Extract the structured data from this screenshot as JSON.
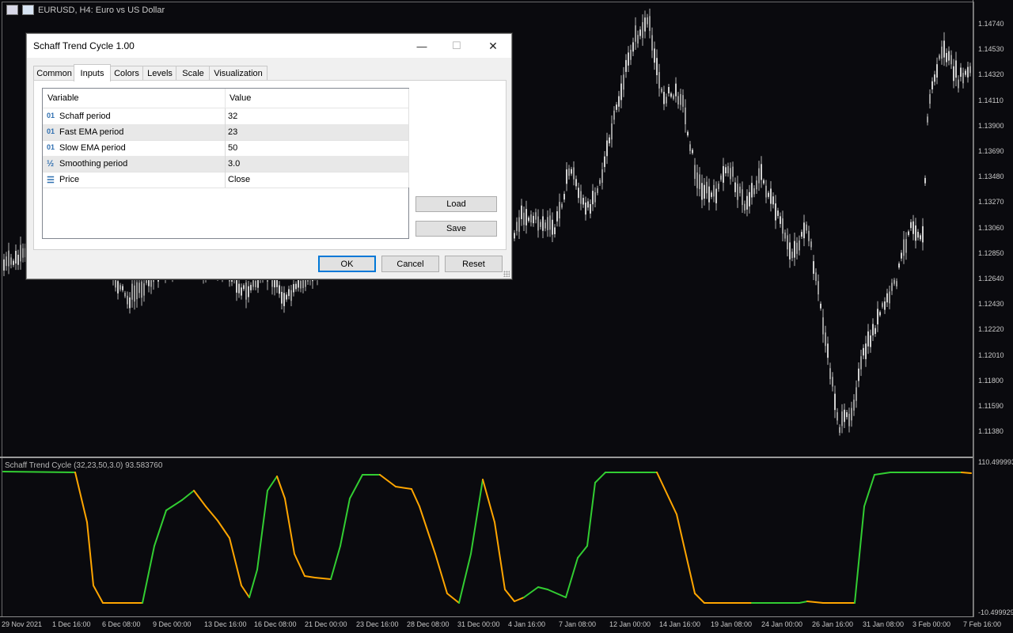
{
  "chart": {
    "title": "EURUSD, H4:  Euro vs US Dollar",
    "indicator_label": "Schaff Trend Cycle (32,23,50,3.0) 93.583760",
    "price_axis": [
      "1.14740",
      "1.14530",
      "1.14320",
      "1.14110",
      "1.13900",
      "1.13690",
      "1.13480",
      "1.13270",
      "1.13060",
      "1.12850",
      "1.12640",
      "1.12430",
      "1.12220",
      "1.12010",
      "1.11800",
      "1.11590",
      "1.11380"
    ],
    "indicator_axis": [
      "110.499993",
      "-10.499929"
    ],
    "time_axis": [
      "29 Nov 2021",
      "1 Dec 16:00",
      "6 Dec 08:00",
      "9 Dec 00:00",
      "13 Dec 16:00",
      "16 Dec 08:00",
      "21 Dec 00:00",
      "23 Dec 16:00",
      "28 Dec 08:00",
      "31 Dec 00:00",
      "4 Jan 16:00",
      "7 Jan 08:00",
      "12 Jan 00:00",
      "14 Jan 16:00",
      "19 Jan 08:00",
      "24 Jan 00:00",
      "26 Jan 16:00",
      "31 Jan 08:00",
      "3 Feb 00:00",
      "7 Feb 16:00"
    ],
    "colors": {
      "background": "#0a0a0e",
      "candle": "#b4b4b4",
      "stc_up": "#32cd32",
      "stc_down": "#ffa500"
    }
  },
  "dialog": {
    "title": "Schaff Trend Cycle 1.00",
    "tabs": [
      "Common",
      "Inputs",
      "Colors",
      "Levels",
      "Scale",
      "Visualization"
    ],
    "active_tab": "Inputs",
    "grid": {
      "headers": {
        "variable": "Variable",
        "value": "Value"
      },
      "rows": [
        {
          "icon": "01",
          "icon_name": "integer-icon",
          "name": "Schaff period",
          "value": "32"
        },
        {
          "icon": "01",
          "icon_name": "integer-icon",
          "name": "Fast EMA period",
          "value": "23"
        },
        {
          "icon": "01",
          "icon_name": "integer-icon",
          "name": "Slow EMA period",
          "value": "50"
        },
        {
          "icon": "½",
          "icon_name": "double-icon",
          "name": "Smoothing period",
          "value": "3.0"
        },
        {
          "icon": "☰",
          "icon_name": "enum-icon",
          "name": "Price",
          "value": "Close"
        }
      ]
    },
    "buttons": {
      "load": "Load",
      "save": "Save",
      "ok": "OK",
      "cancel": "Cancel",
      "reset": "Reset"
    },
    "window_controls": {
      "minimize": "—",
      "maximize": "☐",
      "close": "✕"
    }
  }
}
